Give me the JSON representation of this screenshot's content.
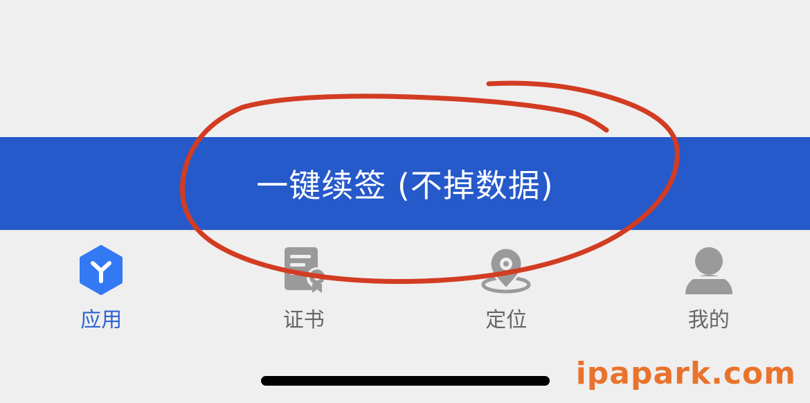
{
  "banner": {
    "label": "一键续签 (不掉数据)",
    "color": "#2659c9"
  },
  "tabs": [
    {
      "label": "应用",
      "icon": "cube-y-icon",
      "active": true
    },
    {
      "label": "证书",
      "icon": "certificate-icon",
      "active": false
    },
    {
      "label": "定位",
      "icon": "location-icon",
      "active": false
    },
    {
      "label": "我的",
      "icon": "user-icon",
      "active": false
    }
  ],
  "colors": {
    "accent": "#2d63d4",
    "inactive_icon": "#9a9a9a",
    "annotation": "#d23c22",
    "background": "#efefef"
  },
  "watermark": "ipapark.com"
}
